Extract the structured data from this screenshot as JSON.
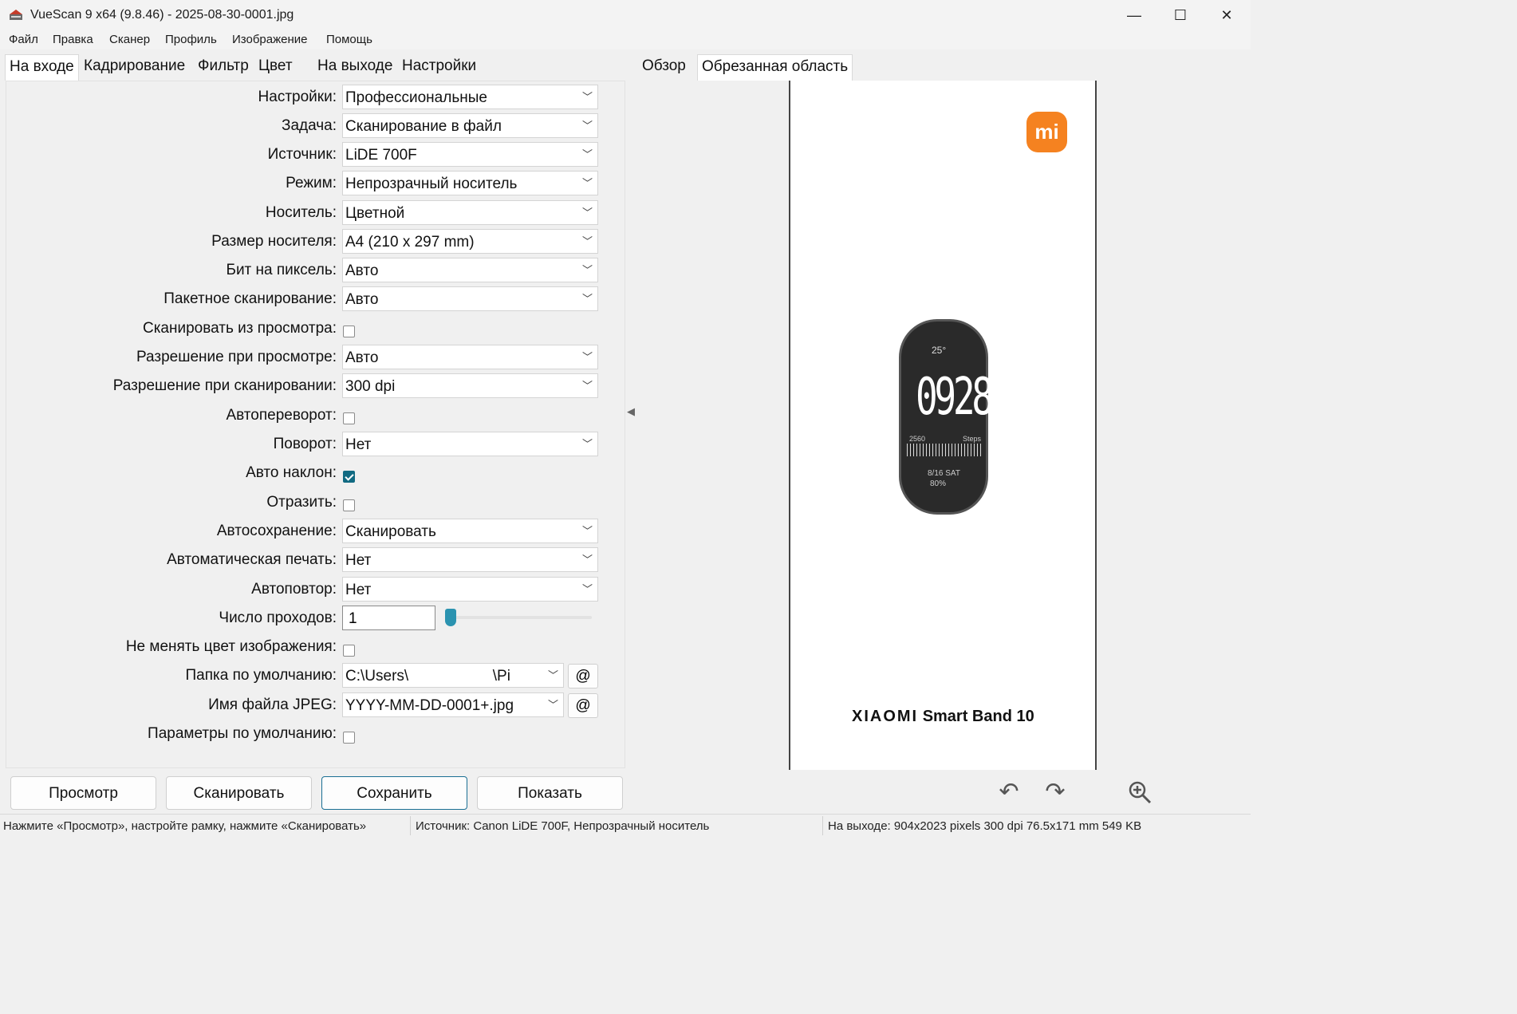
{
  "window": {
    "title": "VueScan 9 x64 (9.8.46) - 2025-08-30-0001.jpg",
    "minimize": "—",
    "maximize": "☐",
    "close": "✕"
  },
  "menu": [
    "Файл",
    "Правка",
    "Сканер",
    "Профиль",
    "Изображение",
    "Помощь"
  ],
  "left_tabs": [
    "На входе",
    "Кадрирование",
    "Фильтр",
    "Цвет",
    "На выходе",
    "Настройки"
  ],
  "right_tabs": [
    "Обзор",
    "Обрезанная область"
  ],
  "settings": {
    "profile": {
      "label": "Настройки:",
      "value": "Профессиональные"
    },
    "task": {
      "label": "Задача:",
      "value": "Сканирование в файл"
    },
    "source": {
      "label": "Источник:",
      "value": "LiDE 700F"
    },
    "mode": {
      "label": "Режим:",
      "value": "Непрозрачный носитель"
    },
    "media": {
      "label": "Носитель:",
      "value": "Цветной"
    },
    "media_size": {
      "label": "Размер носителя:",
      "value": "A4 (210 x 297 mm)"
    },
    "bits_per_pixel": {
      "label": "Бит на пиксель:",
      "value": "Авто"
    },
    "batch_scan": {
      "label": "Пакетное сканирование:",
      "value": "Авто"
    },
    "scan_from_preview": {
      "label": "Сканировать из просмотра:",
      "checked": false
    },
    "preview_resolution": {
      "label": "Разрешение при просмотре:",
      "value": "Авто"
    },
    "scan_resolution": {
      "label": "Разрешение при сканировании:",
      "value": "300 dpi"
    },
    "auto_flip": {
      "label": "Автопереворот:",
      "checked": false
    },
    "rotation": {
      "label": "Поворот:",
      "value": "Нет"
    },
    "auto_deskew": {
      "label": "Авто наклон:",
      "checked": true
    },
    "mirror": {
      "label": "Отразить:",
      "checked": false
    },
    "auto_save": {
      "label": "Автосохранение:",
      "value": "Сканировать"
    },
    "auto_print": {
      "label": "Автоматическая печать:",
      "value": "Нет"
    },
    "auto_repeat": {
      "label": "Автоповтор:",
      "value": "Нет"
    },
    "passes": {
      "label": "Число проходов:",
      "value": "1",
      "slider_fraction": 0.0
    },
    "keep_image_color": {
      "label": "Не менять цвет изображения:",
      "checked": false
    },
    "default_folder": {
      "label": "Папка по умолчанию:",
      "value": "C:\\Users\\                    \\Pi",
      "at_label": "@"
    },
    "jpeg_filename": {
      "label": "Имя файла JPEG:",
      "value": "YYYY-MM-DD-0001+.jpg",
      "at_label": "@"
    },
    "default_options": {
      "label": "Параметры по умолчанию:",
      "checked": false
    }
  },
  "preview": {
    "logo_text": "mi",
    "band_temp": "25°",
    "band_time": "0928",
    "band_steps": "2560",
    "band_steps_label": "Steps",
    "band_date": "8/16 SAT",
    "band_battery": "80%",
    "product_brand": "XIAOMI",
    "product_model": "Smart Band 10"
  },
  "buttons": {
    "preview": "Просмотр",
    "scan": "Сканировать",
    "save": "Сохранить",
    "show": "Показать"
  },
  "icons": {
    "rotate_left": "rotate-left-icon",
    "rotate_right": "rotate-right-icon",
    "zoom_in": "zoom-in-icon"
  },
  "status": {
    "hint": "Нажмите «Просмотр», настройте рамку, нажмите «Сканировать»",
    "source": "Источник: Canon LiDE 700F, Непрозрачный носитель",
    "output": "На выходе: 904x2023 pixels 300 dpi 76.5x171 mm 549 KB"
  },
  "colors": {
    "accent": "#116a82",
    "slider": "#2b93b0",
    "mi_orange": "#f58220"
  }
}
